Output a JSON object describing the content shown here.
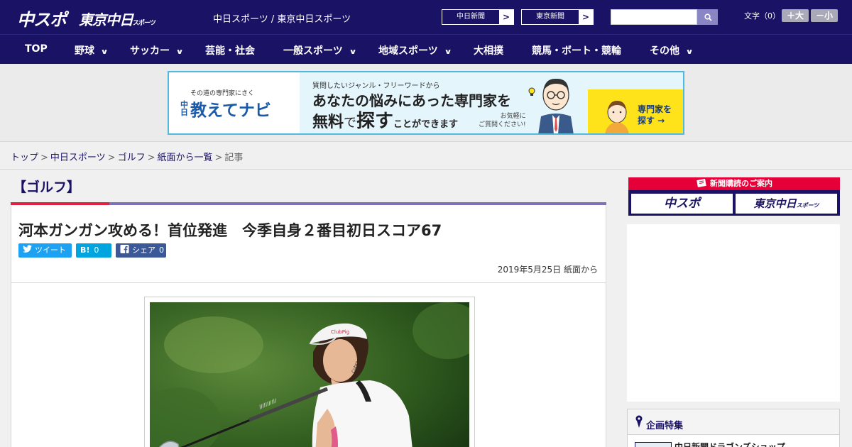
{
  "header": {
    "logo_chuspo": "中スポ",
    "logo_tokyo": "東京中日",
    "logo_tokyo_suffix": "スポーツ",
    "tagline": "中日スポーツ / 東京中日スポーツ",
    "paper_buttons": [
      {
        "label": "中日新聞",
        "arrow": ">"
      },
      {
        "label": "東京新聞",
        "arrow": ">"
      }
    ],
    "search_placeholder": "",
    "fontsize_label": "文字（0）",
    "fontsize_plus": "＋大",
    "fontsize_minus": "－小"
  },
  "nav": {
    "items": [
      {
        "label": "TOP",
        "has_menu": false
      },
      {
        "label": "野球",
        "has_menu": true
      },
      {
        "label": "サッカー",
        "has_menu": true
      },
      {
        "label": "芸能・社会",
        "has_menu": false
      },
      {
        "label": "一般スポーツ",
        "has_menu": true
      },
      {
        "label": "地域スポーツ",
        "has_menu": true
      },
      {
        "label": "大相撲",
        "has_menu": false
      },
      {
        "label": "競馬・ボート・競輪",
        "has_menu": false
      },
      {
        "label": "その他",
        "has_menu": true
      }
    ],
    "chevron": "∨"
  },
  "ad": {
    "small": "その道の専門家にきく",
    "brand_pre": "中日",
    "brand": "教えてナビ",
    "sub": "質問したいジャンル・フリーワードから",
    "headline1": "あなたの悩みにあった専門家を",
    "headline2_a": "無料",
    "headline2_b": "で",
    "headline2_c": "探す",
    "headline2_d": "ことができます",
    "note1": "お気軽に",
    "note2": "ご質問ください!",
    "cta1": "専門家を",
    "cta2": "探す →"
  },
  "breadcrumb": {
    "items": [
      "トップ",
      "中日スポーツ",
      "ゴルフ",
      "紙面から一覧"
    ],
    "current": "記事",
    "separator": ">"
  },
  "article": {
    "category": "【ゴルフ】",
    "headline": "河本ガンガン攻める！首位発進　今季自身２番目初日スコア67",
    "share": {
      "tweet_label": "ツイート",
      "hatena_label": "B!",
      "hatena_count": "0",
      "facebook_label": "シェア",
      "facebook_count": "0"
    },
    "date": "2019年5月25日 紙面から"
  },
  "sidebar": {
    "subscription_title": "新聞購読のご案内",
    "sub_chuspo": "中スポ",
    "sub_tokyo": "東京中日",
    "sub_tokyo_suffix": "スポーツ",
    "feature_title": "企画特集",
    "feature_item": "中日新聞ドラゴンズショップ"
  },
  "colors": {
    "brand_navy": "#1a1264",
    "accent_red": "#e60039",
    "twitter": "#1da1f2",
    "hatena": "#00a4de",
    "facebook": "#3b5998"
  }
}
